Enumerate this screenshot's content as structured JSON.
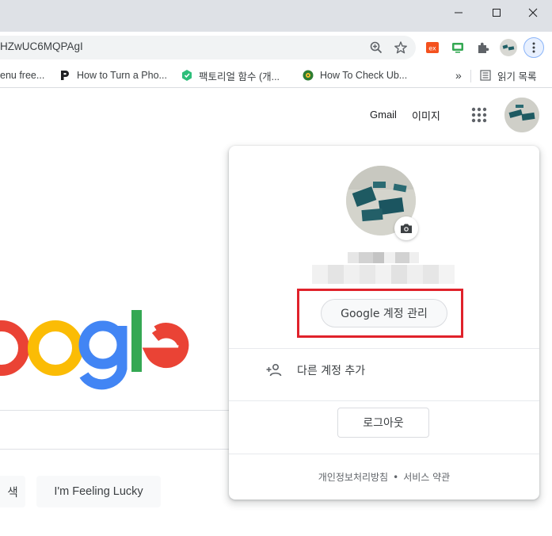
{
  "window": {
    "minimize_label": "",
    "maximize_label": "",
    "close_label": ""
  },
  "address_bar": {
    "url": "HZwUC6MQPAgI"
  },
  "bookmarks": [
    {
      "label": "enu free...",
      "icon": "page-icon"
    },
    {
      "label": "How to Turn a Pho...",
      "icon": "p-logo-icon"
    },
    {
      "label": "팩토리얼 함수 (개...",
      "icon": "green-hex-icon"
    },
    {
      "label": "How To Check Ub...",
      "icon": "gear-logo-icon"
    }
  ],
  "reading_list": {
    "label": "읽기 목록",
    "more": "»"
  },
  "header_links": {
    "gmail": "Gmail",
    "images": "이미지"
  },
  "logo_text": "oogle",
  "logo_colors": {
    "o1": "#ea4335",
    "o2": "#fbbc05",
    "g": "#4285f4",
    "l": "#34a853",
    "e": "#ea4335"
  },
  "buttons": {
    "search": "색",
    "lucky": "I'm Feeling Lucky"
  },
  "account_popup": {
    "manage_account": "Google 계정 관리",
    "add_account": "다른 계정 추가",
    "sign_out": "로그아웃",
    "footer": {
      "privacy": "개인정보처리방침",
      "separator": "•",
      "terms": "서비스 약관"
    }
  },
  "colors": {
    "highlight_box": "#e0222b",
    "chrome_frame": "#dee1e6"
  }
}
